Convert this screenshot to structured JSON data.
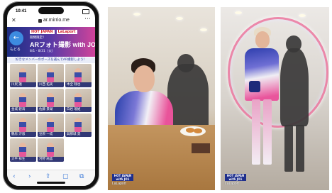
{
  "phone": {
    "status_time": "10:41",
    "url": "ar.mirrio.me",
    "close_glyph": "✕",
    "more_glyph": "⋯",
    "back_label": "もどる",
    "back_glyph": "←",
    "logos": [
      "HOT JAPAN",
      "LaLaport"
    ],
    "subtitle": "期間限定！",
    "title": "ARフォト撮影 with JO1",
    "date": "8/1 - 8/31（火）",
    "notice": "好きなメンバーのポーズを選んでAR撮影しよう！",
    "tiles": [
      {
        "name": "川尻 蓮"
      },
      {
        "name": "川西 拓実"
      },
      {
        "name": "木全 翔也"
      },
      {
        "name": "金城 碧海"
      },
      {
        "name": "佐藤 景瑚"
      },
      {
        "name": "白岩 瑠姫"
      },
      {
        "name": "鶴房 汐恩"
      },
      {
        "name": "豆原 一成"
      },
      {
        "name": "與那城 奨"
      },
      {
        "name": "大平 祥生"
      },
      {
        "name": "河野 純喜"
      }
    ],
    "toolbar_icons": [
      "back-icon",
      "forward-icon",
      "share-icon",
      "bookmarks-icon",
      "tabs-icon"
    ]
  },
  "photo1": {
    "watermark_badge": "HOT JAPAN with JO1",
    "watermark_text": "LaLaport"
  },
  "photo2": {
    "watermark_badge": "HOT JAPAN with JO1",
    "watermark_text": "LaLaport"
  },
  "colors": {
    "banner_start": "#1d2d82",
    "banner_end": "#d0439a",
    "back_button": "#3d8be0",
    "brand_navy": "#1f2f8c"
  }
}
